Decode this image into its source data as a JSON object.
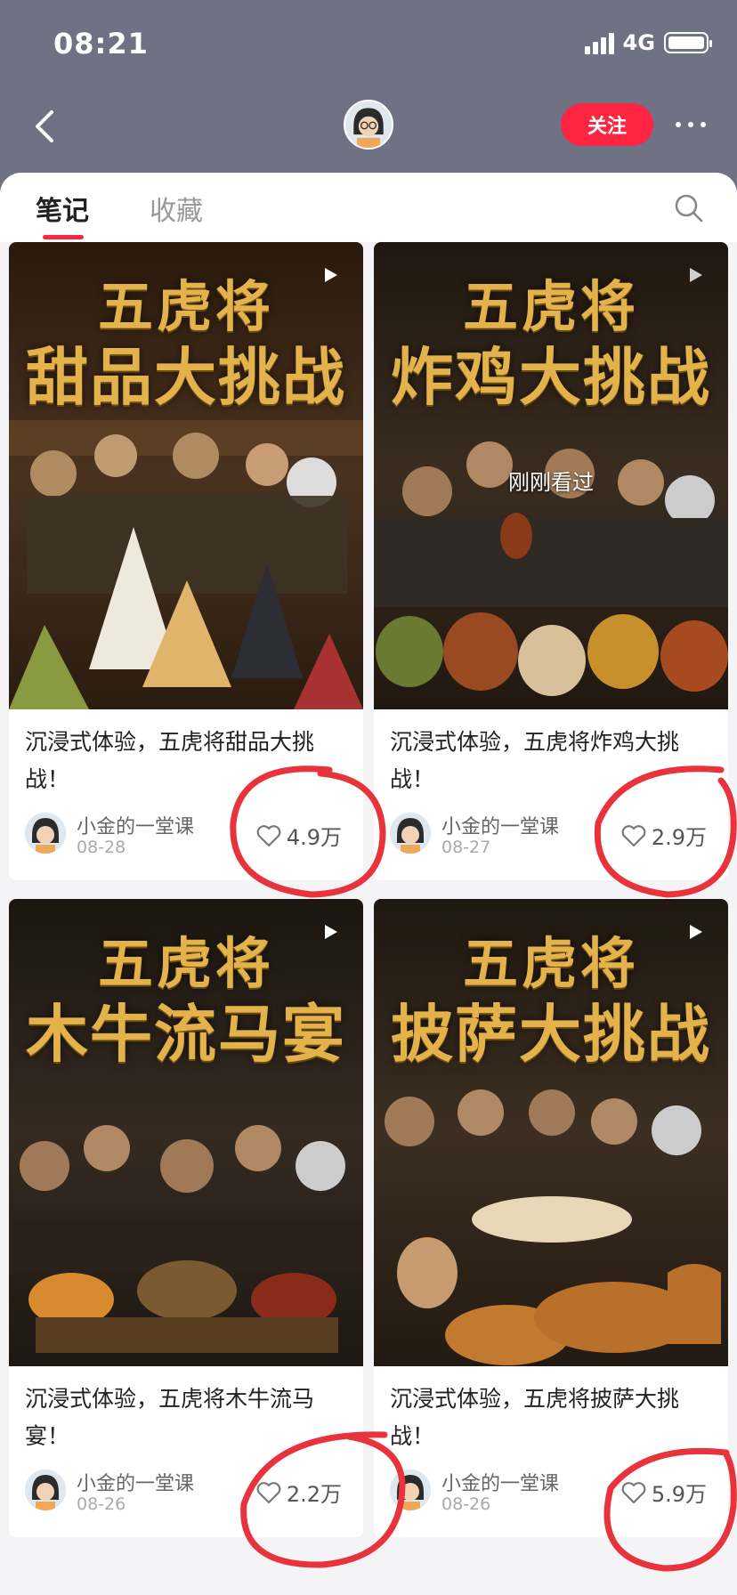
{
  "status": {
    "time": "08:21",
    "network": "4G"
  },
  "nav": {
    "follow_label": "关注"
  },
  "tabs": [
    {
      "label": "笔记"
    },
    {
      "label": "收藏"
    }
  ],
  "notes": [
    {
      "cover_line1": "五虎将",
      "cover_line2": "甜品大挑战",
      "title": "沉浸式体验，五虎将甜品大挑战！",
      "author": "小金的一堂课",
      "date": "08-28",
      "likes": "4.9万",
      "viewed": ""
    },
    {
      "cover_line1": "五虎将",
      "cover_line2": "炸鸡大挑战",
      "title": "沉浸式体验，五虎将炸鸡大挑战！",
      "author": "小金的一堂课",
      "date": "08-27",
      "likes": "2.9万",
      "viewed": "刚刚看过"
    },
    {
      "cover_line1": "五虎将",
      "cover_line2": "木牛流马宴",
      "title": "沉浸式体验，五虎将木牛流马宴！",
      "author": "小金的一堂课",
      "date": "08-26",
      "likes": "2.2万",
      "viewed": ""
    },
    {
      "cover_line1": "五虎将",
      "cover_line2": "披萨大挑战",
      "title": "沉浸式体验，五虎将披萨大挑战！",
      "author": "小金的一堂课",
      "date": "08-26",
      "likes": "5.9万",
      "viewed": ""
    }
  ],
  "colors": {
    "accent": "#ff2442",
    "header_bg": "#6f7283",
    "annotation": "#e8323c"
  }
}
